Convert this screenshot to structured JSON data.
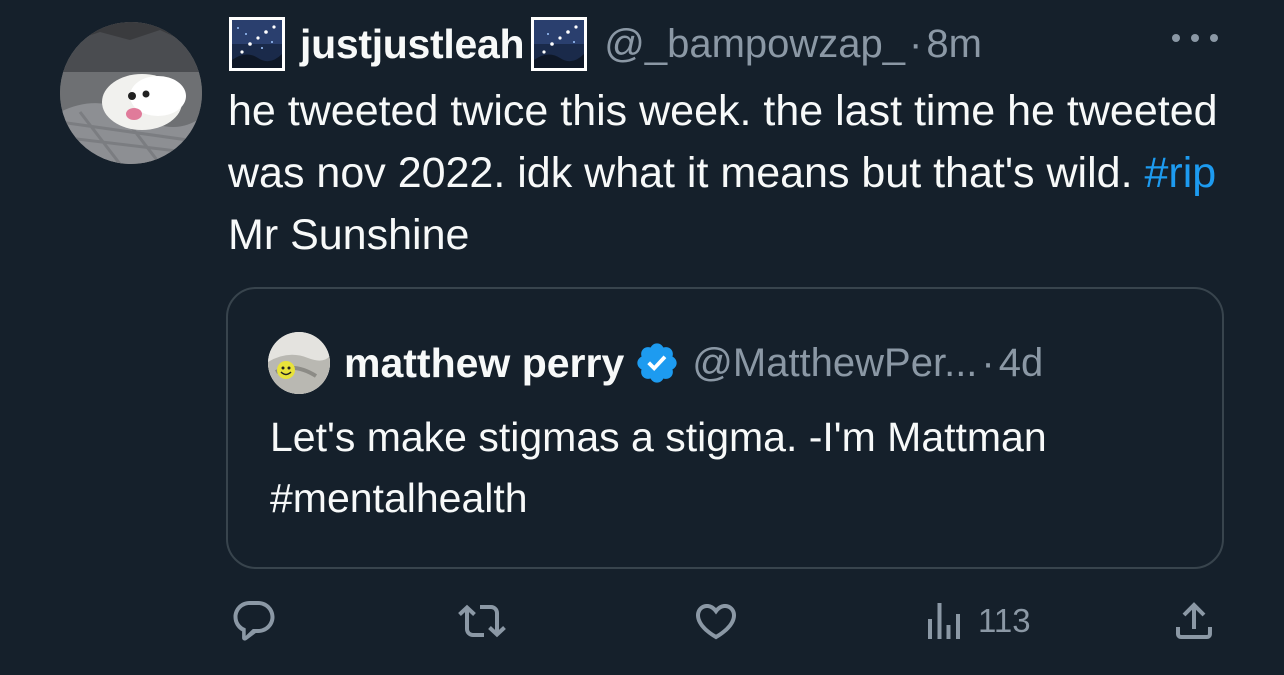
{
  "tweet": {
    "author": {
      "display_name": "justjustleah",
      "handle": "@_bampowzap_",
      "separator": "·",
      "time": "8m"
    },
    "text_parts": {
      "before_hashtag": "he tweeted twice this week. the last time he tweeted was nov 2022. idk what it means but that's wild. ",
      "hashtag": "#rip",
      "after_hashtag": " Mr Sunshine"
    },
    "quote": {
      "display_name": "matthew perry",
      "handle": "@MatthewPer...",
      "separator": "·",
      "time": "4d",
      "text": "Let's make stigmas a stigma. -I'm Mattman #mentalhealth"
    },
    "actions": {
      "views_count": "113"
    },
    "icons": {
      "more": "more-icon",
      "reply": "reply-icon",
      "retweet": "retweet-icon",
      "like": "heart-icon",
      "views": "views-icon",
      "share": "share-icon",
      "verified": "verified-badge-icon"
    },
    "colors": {
      "background": "#15202b",
      "text": "#f7f9f9",
      "secondary": "#8b98a5",
      "link": "#1d9bf0",
      "border": "#38444d"
    }
  }
}
